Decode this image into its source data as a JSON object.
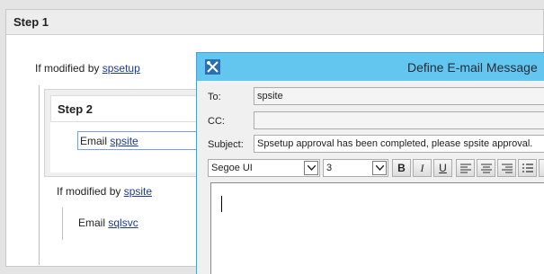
{
  "designer": {
    "step1_title": "Step 1",
    "cond1": {
      "prefix": "If modified by",
      "user": "spsetup"
    },
    "step2_title": "Step 2",
    "action1": {
      "prefix": "Email",
      "user": "spsite"
    },
    "cond2": {
      "prefix": "If modified by",
      "user": "spsite"
    },
    "action2": {
      "prefix": "Email",
      "user": "sqlsvc"
    }
  },
  "dialog": {
    "title": "Define E-mail Message",
    "to_label": "To:",
    "to_value": "spsite",
    "cc_label": "CC:",
    "cc_value": "",
    "subject_label": "Subject:",
    "subject_value": "Spsetup approval has been completed, please spsite approval.",
    "font_name": "Segoe UI",
    "font_size": "3",
    "bold_label": "B",
    "italic_label": "I",
    "underline_label": "U",
    "body_text": ""
  }
}
